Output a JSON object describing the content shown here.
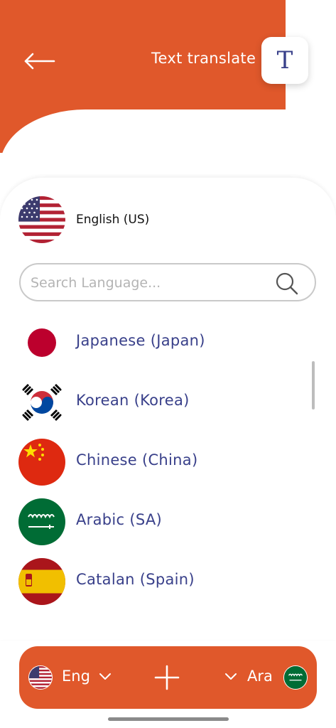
{
  "header": {
    "title": "Text translate",
    "mode_icon_label": "T",
    "back_icon": "arrow-left-icon"
  },
  "selected_language": {
    "label": "English (US)",
    "flag": "us-flag"
  },
  "search": {
    "placeholder": "Search Language...",
    "value": ""
  },
  "languages": [
    {
      "label": "Japanese (Japan)",
      "flag": "japan-flag"
    },
    {
      "label": "Korean (Korea)",
      "flag": "korea-flag"
    },
    {
      "label": "Chinese (China)",
      "flag": "china-flag"
    },
    {
      "label": "Arabic (SA)",
      "flag": "saudi-arabia-flag"
    },
    {
      "label": "Catalan (Spain)",
      "flag": "spain-flag"
    }
  ],
  "bottom_bar": {
    "source_label": "Eng",
    "target_label": "Ara",
    "source_flag": "us-flag",
    "target_flag": "saudi-arabia-flag"
  },
  "colors": {
    "accent": "#E0582B",
    "text_primary": "#39408A"
  }
}
